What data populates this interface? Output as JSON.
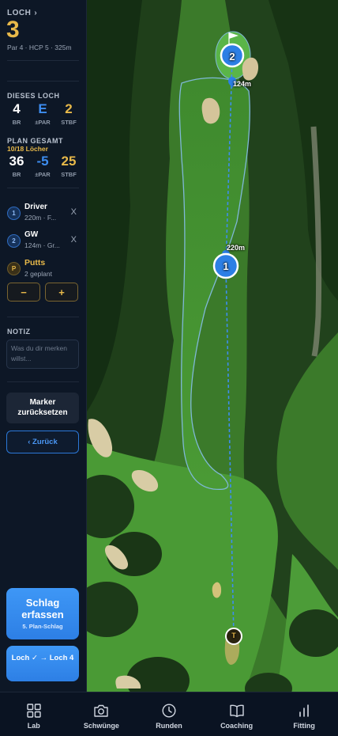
{
  "hole": {
    "label": "LOCH",
    "number": "3",
    "meta": "Par 4 · HCP 5 · 325m"
  },
  "this_hole": {
    "title": "DIESES LOCH",
    "stats": [
      {
        "value": "4",
        "label": "BR",
        "color": "#ffffff"
      },
      {
        "value": "E",
        "label": "±PAR",
        "color": "#3d8df0"
      },
      {
        "value": "2",
        "label": "STBF",
        "color": "#e8b94a"
      }
    ]
  },
  "plan_total": {
    "title": "PLAN GESAMT",
    "subtitle": "10/18 Löcher",
    "stats": [
      {
        "value": "36",
        "label": "BR",
        "color": "#ffffff"
      },
      {
        "value": "-5",
        "label": "±PAR",
        "color": "#3d8df0"
      },
      {
        "value": "25",
        "label": "STBF",
        "color": "#e8b94a"
      }
    ]
  },
  "plan_shots": [
    {
      "badge": "1",
      "club": "Driver",
      "info": "220m · F...",
      "remove": "X"
    },
    {
      "badge": "2",
      "club": "GW",
      "info": "124m · Gr...",
      "remove": "X"
    }
  ],
  "putts": {
    "badge": "P",
    "label": "Putts",
    "info": "2 geplant",
    "minus": "−",
    "plus": "+"
  },
  "note": {
    "title": "NOTIZ",
    "placeholder": "Was du dir merken willst..."
  },
  "buttons": {
    "reset": "Marker zurücksetzen",
    "back": "‹ Zurück",
    "capture_title": "Schlag erfassen",
    "capture_sub": "5. Plan-Schlag",
    "next_hole": "Loch ✓ → Loch 4"
  },
  "map": {
    "markers": [
      {
        "id": "2",
        "distance": "124m"
      },
      {
        "id": "1",
        "distance": "220m"
      }
    ],
    "tee": "T",
    "colors": {
      "route": "#3d8df0",
      "marker": "#2d7fe5",
      "fairway_outline": "#7fb8d8",
      "tee": "#e8b94a"
    }
  },
  "bottom_nav": [
    {
      "label": "Lab",
      "icon": "grid-icon"
    },
    {
      "label": "Schwünge",
      "icon": "camera-icon"
    },
    {
      "label": "Runden",
      "icon": "clock-icon"
    },
    {
      "label": "Coaching",
      "icon": "book-icon"
    },
    {
      "label": "Fitting",
      "icon": "bar-chart-icon"
    }
  ]
}
